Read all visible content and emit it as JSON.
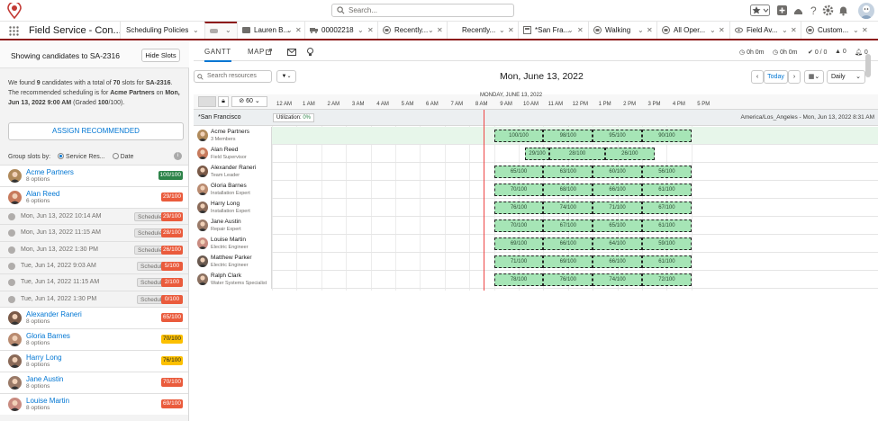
{
  "top": {
    "search_placeholder": "Search..."
  },
  "app": {
    "name": "Field Service - Con...",
    "tabs": [
      {
        "label": "Scheduling Policies"
      },
      {
        "label": ""
      },
      {
        "label": "Lauren B..."
      },
      {
        "label": "00002218"
      },
      {
        "label": "Recently..."
      },
      {
        "label": "Recently..."
      },
      {
        "label": "*San Fra..."
      },
      {
        "label": "Walking"
      },
      {
        "label": "All Oper..."
      },
      {
        "label": "Field Av..."
      },
      {
        "label": "Custom..."
      }
    ]
  },
  "left": {
    "header": "Showing candidates to SA-2316",
    "hide_slots": "Hide Slots",
    "found_pre": "We found ",
    "found_count": "9",
    "found_mid": " candidates with a total of ",
    "found_slots": "70",
    "found_mid2": " slots for ",
    "found_sa": "SA-2316",
    "found_mid3": ". The recommended scheduling is for ",
    "found_rec": "Acme Partners",
    "found_mid4": " on ",
    "found_date": "Mon, Jun 13, 2022 9:00 AM",
    "found_grade_pre": " (Graded ",
    "found_grade": "100",
    "found_grade_post": "/100).",
    "assign": "ASSIGN RECOMMENDED",
    "group_label": "Group slots by:",
    "group_opt1": "Service Res...",
    "group_opt2": "Date",
    "rows": [
      {
        "type": "person",
        "name": "Acme Partners",
        "sub": "8 options",
        "score": "100/100",
        "color": "green",
        "av": "#b08a5b"
      },
      {
        "type": "person",
        "name": "Alan Reed",
        "sub": "6 options",
        "score": "29/100",
        "color": "red",
        "av": "#c77a5c"
      },
      {
        "type": "slot",
        "name": "Mon, Jun 13, 2022 10:14 AM",
        "sched": "Schedule",
        "score": "29/100",
        "color": "red"
      },
      {
        "type": "slot",
        "name": "Mon, Jun 13, 2022 11:15 AM",
        "sched": "Schedule",
        "score": "28/100",
        "color": "red"
      },
      {
        "type": "slot",
        "name": "Mon, Jun 13, 2022 1:30 PM",
        "sched": "Schedule",
        "score": "26/100",
        "color": "red"
      },
      {
        "type": "slot",
        "name": "Tue, Jun 14, 2022 9:03 AM",
        "sched": "Schedule",
        "score": "5/100",
        "color": "red"
      },
      {
        "type": "slot",
        "name": "Tue, Jun 14, 2022 11:15 AM",
        "sched": "Schedule",
        "score": "2/100",
        "color": "red"
      },
      {
        "type": "slot",
        "name": "Tue, Jun 14, 2022 1:30 PM",
        "sched": "Schedule",
        "score": "0/100",
        "color": "red"
      },
      {
        "type": "person",
        "name": "Alexander Raneri",
        "sub": "8 options",
        "score": "65/100",
        "color": "red",
        "av": "#7a5a48"
      },
      {
        "type": "person",
        "name": "Gloria Barnes",
        "sub": "8 options",
        "score": "70/100",
        "color": "yellow",
        "av": "#b98b70"
      },
      {
        "type": "person",
        "name": "Harry Long",
        "sub": "8 options",
        "score": "76/100",
        "color": "yellow",
        "av": "#8a6a58"
      },
      {
        "type": "person",
        "name": "Jane Austin",
        "sub": "8 options",
        "score": "70/100",
        "color": "red",
        "av": "#9a7a68"
      },
      {
        "type": "person",
        "name": "Louise Martin",
        "sub": "8 options",
        "score": "69/100",
        "color": "red",
        "av": "#c98b80"
      }
    ]
  },
  "gantt": {
    "tab_gantt": "GANTT",
    "tab_map": "MAP",
    "stat1": "0h 0m",
    "stat2": "0h 0m",
    "stat3": "0 / 0",
    "stat4": "0",
    "stat5": "0",
    "search_placeholder": "Search resources",
    "date": "Mon, June 13, 2022",
    "today": "Today",
    "view": "Daily",
    "day_head": "MONDAY, JUNE 13, 2022",
    "zoom": "60",
    "hours": [
      "12 AM",
      "1 AM",
      "2 AM",
      "3 AM",
      "4 AM",
      "5 AM",
      "6 AM",
      "7 AM",
      "8 AM",
      "9 AM",
      "10 AM",
      "11 AM",
      "12 PM",
      "1 PM",
      "2 PM",
      "3 PM",
      "4 PM",
      "5 PM"
    ],
    "region": "*San Francisco",
    "utilization_label": "Utilization: ",
    "utilization": "0%",
    "region_right": "America/Los_Angeles - Mon, Jun 13, 2022 8:31 AM",
    "resources": [
      {
        "name": "Acme Partners",
        "sub": "3 Members",
        "av": "#b08a5b",
        "blocks": [
          "100/100",
          "98/100",
          "95/100",
          "90/100"
        ]
      },
      {
        "name": "Alan Reed",
        "sub": "Field Supervisor",
        "av": "#c77a5c",
        "blocks": [
          "29/100",
          "28/100",
          "26/100"
        ]
      },
      {
        "name": "Alexander Raneri",
        "sub": "Team Leader",
        "av": "#7a5a48",
        "blocks": [
          "65/100",
          "63/100",
          "60/100",
          "56/100"
        ]
      },
      {
        "name": "Gloria Barnes",
        "sub": "Installation Expert",
        "av": "#b98b70",
        "blocks": [
          "70/100",
          "68/100",
          "66/100",
          "61/100"
        ]
      },
      {
        "name": "Harry Long",
        "sub": "Installation Expert",
        "av": "#8a6a58",
        "blocks": [
          "76/100",
          "74/100",
          "71/100",
          "67/100"
        ]
      },
      {
        "name": "Jane Austin",
        "sub": "Repair Expert",
        "av": "#9a7a68",
        "blocks": [
          "70/100",
          "67/100",
          "65/100",
          "61/100"
        ]
      },
      {
        "name": "Louise Martin",
        "sub": "Electric Engineer",
        "av": "#c98b80",
        "blocks": [
          "69/100",
          "66/100",
          "64/100",
          "59/100"
        ]
      },
      {
        "name": "Matthew Parker",
        "sub": "Electric Engineer",
        "av": "#6a5a50",
        "blocks": [
          "71/100",
          "69/100",
          "66/100",
          "61/100"
        ]
      },
      {
        "name": "Ralph Clark",
        "sub": "Water Systems Specialist",
        "av": "#8a7060",
        "blocks": [
          "78/100",
          "76/100",
          "74/100",
          "72/100"
        ]
      }
    ]
  }
}
